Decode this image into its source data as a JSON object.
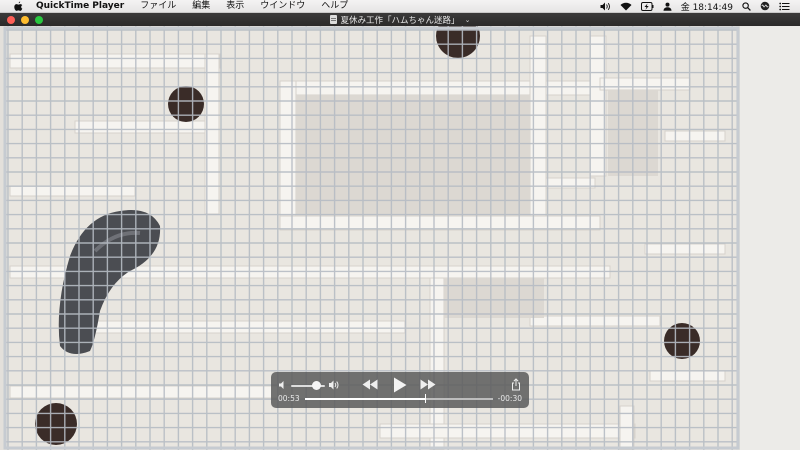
{
  "menubar": {
    "app_name": "QuickTime Player",
    "menus": [
      "ファイル",
      "編集",
      "表示",
      "ウインドウ",
      "ヘルプ"
    ],
    "clock": "金 18:14:49",
    "status_icons": [
      "volume-icon",
      "wifi-icon",
      "battery-charging-icon",
      "user-icon",
      "search-icon",
      "siri-icon",
      "notification-center-icon"
    ]
  },
  "window": {
    "title": "夏休み工作「ハムちゃん迷路」"
  },
  "player": {
    "elapsed": "00:53",
    "remaining": "-00:30",
    "progress": 0.64,
    "volume": 0.75
  },
  "colors": {
    "hud_bg": "#5c5c5c",
    "wall": "#e9e6e1",
    "mesh": "#b9bfc6"
  }
}
